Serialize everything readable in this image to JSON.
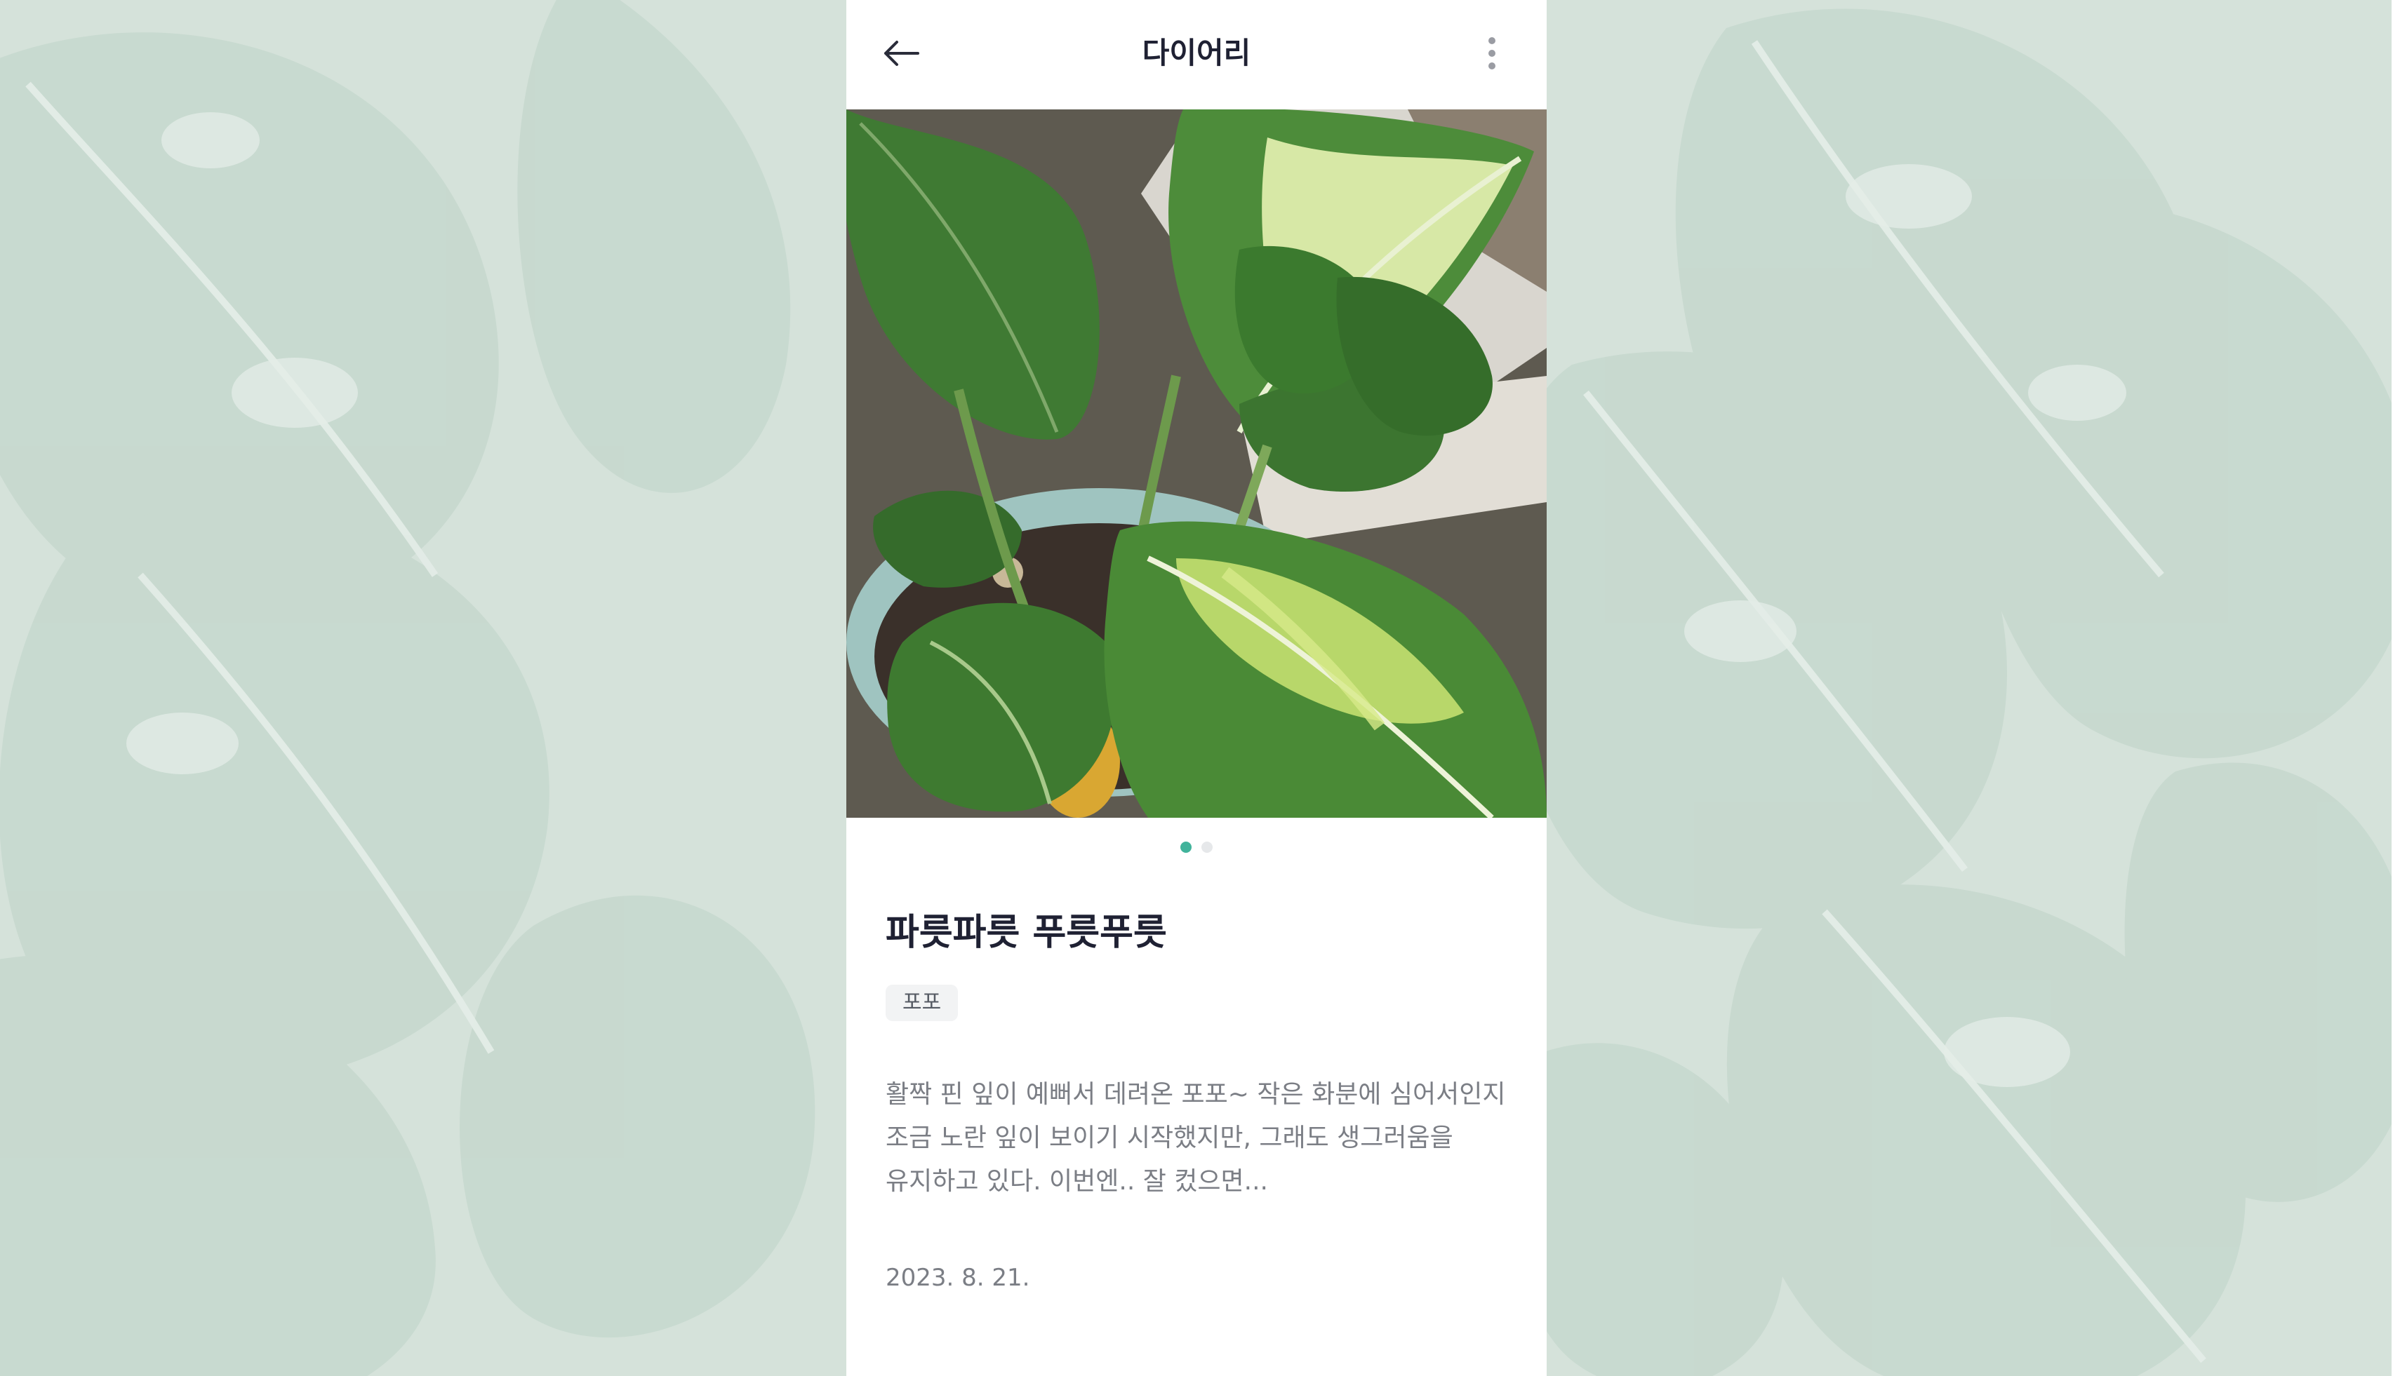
{
  "header": {
    "title": "다이어리",
    "back_icon": "arrow-left-icon",
    "more_icon": "vertical-dots-icon"
  },
  "photo": {
    "subject": "dieffenbachia-plant-photo",
    "page_count": 2,
    "current_page": 1
  },
  "post": {
    "title": "파릇파릇 푸릇푸릇",
    "tag": "포포",
    "body": "활짝 핀 잎이 예뻐서 데려온 포포~ 작은 화분에 심어서인지 조금 노란 잎이 보이기 시작했지만, 그래도 생그러움을 유지하고 있다. 이번엔.. 잘 컸으면...",
    "date": "2023. 8. 21."
  },
  "colors": {
    "background": "#d5e2da",
    "accent": "#41b39b",
    "title_text": "#1f2133",
    "body_text": "#7b7e85"
  }
}
